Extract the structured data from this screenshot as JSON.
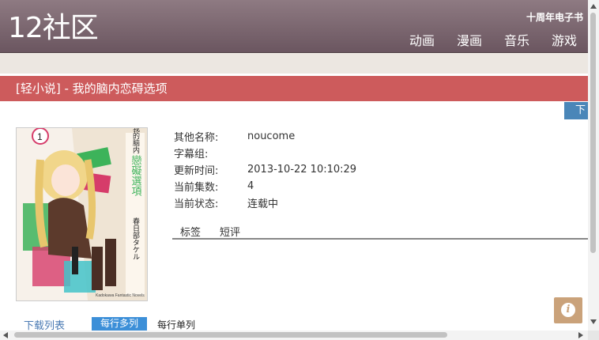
{
  "site": {
    "logo": "12社区",
    "tagline": "十周年电子书",
    "nav": [
      "动画",
      "漫画",
      "音乐",
      "游戏"
    ]
  },
  "page": {
    "title": "[轻小说] - 我的脑内恋碍选项",
    "download_tab": "下"
  },
  "cover": {
    "volume": "1",
    "title_top": "我的脑内",
    "title_main": "戀礙選項",
    "author": "春日部タケル",
    "publisher": "Kadokawa Fantastic Novels"
  },
  "info": {
    "rows": [
      {
        "key": "其他名称:",
        "value": "noucome"
      },
      {
        "key": "字幕组:",
        "value": ""
      },
      {
        "key": "更新时间:",
        "value": "2013-10-22 10:10:29"
      },
      {
        "key": "当前集数:",
        "value": "4"
      },
      {
        "key": "当前状态:",
        "value": "连载中"
      }
    ]
  },
  "tabs": [
    "标签",
    "短评"
  ],
  "download_list": {
    "label": "下载列表",
    "option_multi": "每行多列",
    "option_single": "每行单列"
  },
  "colors": {
    "header": "#7a656e",
    "title_bar": "#cd5b5c",
    "accent_blue": "#3c8fd8",
    "info_button": "#caa27a"
  },
  "icons": {
    "info": "info-icon"
  }
}
